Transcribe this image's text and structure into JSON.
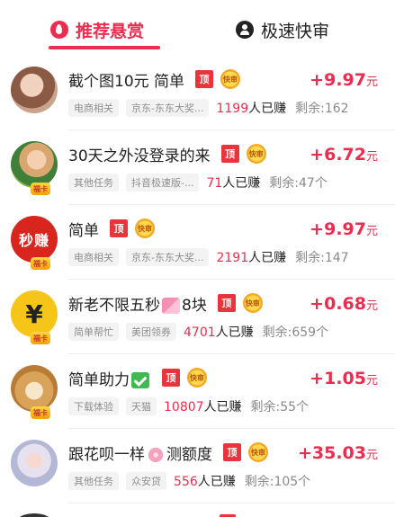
{
  "tabs": [
    {
      "label": "推荐悬赏",
      "icon": "fire-icon",
      "active": true
    },
    {
      "label": "极速快审",
      "icon": "person-icon",
      "active": false
    }
  ],
  "colors": {
    "accent": "#ee2c4f",
    "top_badge": "#e8343a",
    "fast_badge": "#f5a623"
  },
  "badges": {
    "top": "顶",
    "fast": "快审",
    "avatar_tag": "福卡"
  },
  "tasks": [
    {
      "title": "截个图10元 简单",
      "emoji": null,
      "price_prefix": "+",
      "price": "9.97",
      "unit": "元",
      "tags": [
        "电商相关",
        "京东-东东大奖..."
      ],
      "earned_count": "1199",
      "earned_suffix": "人已赚",
      "remain": "剩余:162",
      "avatar": "portrait-avatar"
    },
    {
      "title": "30天之外没登录的来",
      "emoji": null,
      "price_prefix": "+",
      "price": "6.72",
      "unit": "元",
      "tags": [
        "其他任务",
        "抖音极速版-..."
      ],
      "earned_count": "71",
      "earned_suffix": "人已赚",
      "remain": "剩余:47个",
      "avatar": "portrait-avatar"
    },
    {
      "title": "简单",
      "emoji": null,
      "price_prefix": "+",
      "price": "9.97",
      "unit": "元",
      "tags": [
        "电商相关",
        "京东-东东大奖..."
      ],
      "earned_count": "2191",
      "earned_suffix": "人已赚",
      "remain": "剩余:147",
      "avatar": "miaozhuan-avatar",
      "avatar_text": "秒赚"
    },
    {
      "title_before": "新老不限五秒",
      "title_after": "8块",
      "emoji": "gift",
      "price_prefix": "+",
      "price": "0.68",
      "unit": "元",
      "tags": [
        "简单帮忙",
        "美团领券"
      ],
      "earned_count": "4701",
      "earned_suffix": "人已赚",
      "remain": "剩余:659个",
      "avatar": "yen-coin-avatar",
      "avatar_text": "¥"
    },
    {
      "title_before": "简单助力",
      "title_after": "",
      "emoji": "check",
      "price_prefix": "+",
      "price": "1.05",
      "unit": "元",
      "tags": [
        "下载体验",
        "天猫"
      ],
      "earned_count": "10807",
      "earned_suffix": "人已赚",
      "remain": "剩余:55个",
      "avatar": "dog-avatar"
    },
    {
      "title_before": "跟花呗一样",
      "title_after": "测额度",
      "emoji": "flower",
      "price_prefix": "+",
      "price": "35.03",
      "unit": "元",
      "tags": [
        "其他任务",
        "众安贷"
      ],
      "earned_count": "556",
      "earned_suffix": "人已赚",
      "remain": "剩余:105个",
      "avatar": "girl-avatar"
    }
  ]
}
